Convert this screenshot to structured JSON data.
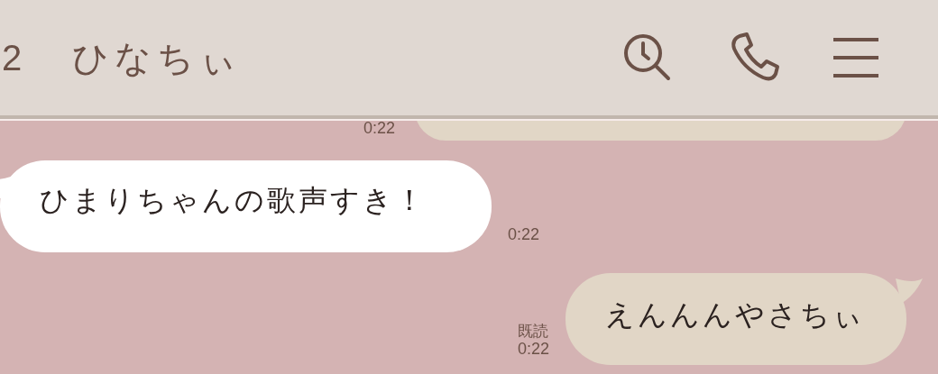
{
  "header": {
    "unread_count": "2",
    "title": "ひなちぃ"
  },
  "messages": [
    {
      "kind": "sent",
      "time": "0:22"
    },
    {
      "kind": "received",
      "text": "ひまりちゃんの歌声すき！",
      "time": "0:22"
    },
    {
      "kind": "sent",
      "text": "えんんんやさちぃ",
      "time": "0:22",
      "read": "既読"
    }
  ]
}
